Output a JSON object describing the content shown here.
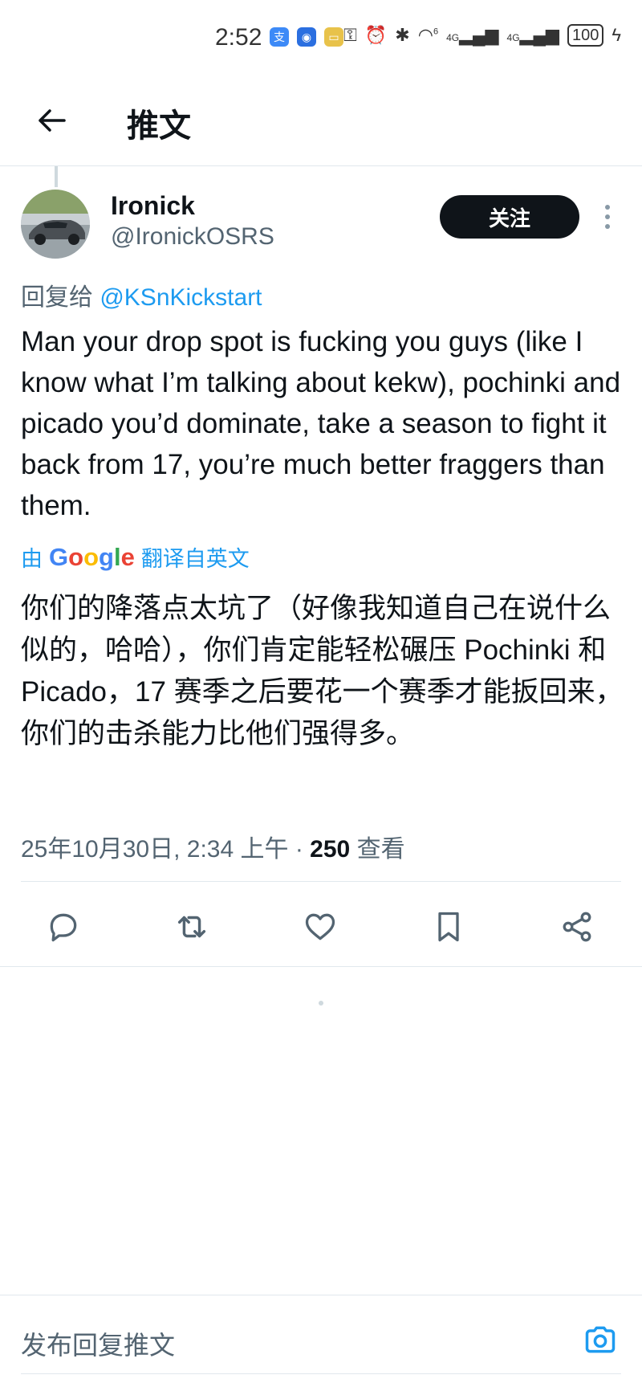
{
  "status_bar": {
    "time": "2:52",
    "network_1": "4G",
    "network_2": "4G",
    "wifi_badge": "6",
    "battery": "100"
  },
  "header": {
    "title": "推文"
  },
  "tweet": {
    "display_name": "Ironick",
    "handle": "@IronickOSRS",
    "follow_label": "关注",
    "reply_prefix": "回复给",
    "reply_to": "@KSnKickstart",
    "text": "Man your drop spot is fucking you guys (like I know what I’m talking about kekw), pochinki and picado you’d dominate, take a season to fight it back from 17, you’re much better fraggers than them.",
    "translation_by": "由",
    "translation_brand": "Google",
    "translation_suffix": "翻译自英文",
    "translated_text": "你们的降落点太坑了（好像我知道自己在说什么似的，哈哈），你们肯定能轻松碾压 Pochinki 和 Picado，17 赛季之后要花一个赛季才能扳回来，你们的击杀能力比他们强得多。",
    "timestamp": "25年10月30日, 2:34 上午 · ",
    "views_count": "250",
    "views_label": " 查看"
  },
  "actions": [
    "reply-icon",
    "retweet-icon",
    "like-icon",
    "bookmark-icon",
    "share-icon"
  ],
  "composer": {
    "placeholder": "发布回复推文"
  },
  "colors": {
    "accent": "#1d9bf0",
    "text_primary": "#0f1419",
    "text_secondary": "#536471",
    "divider": "#e1e8ed"
  }
}
